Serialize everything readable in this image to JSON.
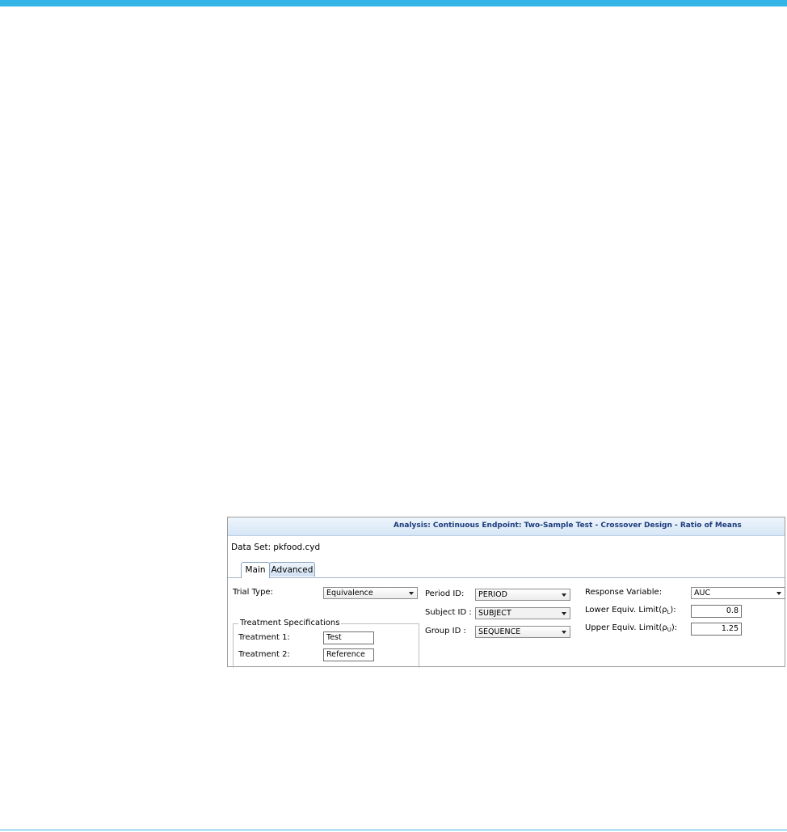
{
  "window": {
    "title": "Analysis: Continuous Endpoint: Two-Sample Test - Crossover Design - Ratio of Means"
  },
  "dataset": {
    "label": "Data Set:",
    "value": "pkfood.cyd"
  },
  "tabs": [
    {
      "label": "Main",
      "selected": true
    },
    {
      "label": "Advanced",
      "selected": false
    }
  ],
  "trial": {
    "label": "Trial Type:",
    "value": "Equivalence"
  },
  "treatment": {
    "group_title": "Treatment Specifications",
    "t1_label": "Treatment 1:",
    "t1_value": "Test",
    "t2_label": "Treatment 2:",
    "t2_value": "Reference"
  },
  "ids": {
    "period_label": "Period ID:",
    "period_value": "PERIOD",
    "subject_label": "Subject ID :",
    "subject_value": "SUBJECT",
    "group_label": "Group ID :",
    "group_value": "SEQUENCE"
  },
  "response": {
    "label": "Response Variable:",
    "value": "AUC",
    "lower_label_prefix": "Lower Equiv. Limit(ρ",
    "lower_sub": "L",
    "lower_label_suffix": "):",
    "lower_value": "0.8",
    "upper_label_prefix": "Upper Equiv. Limit(ρ",
    "upper_sub": "U",
    "upper_label_suffix": "):",
    "upper_value": "1.25"
  },
  "colors": {
    "accent": "#35b4e8",
    "title_text": "#1c3c7c",
    "title_bg": "#d6e6f6"
  }
}
